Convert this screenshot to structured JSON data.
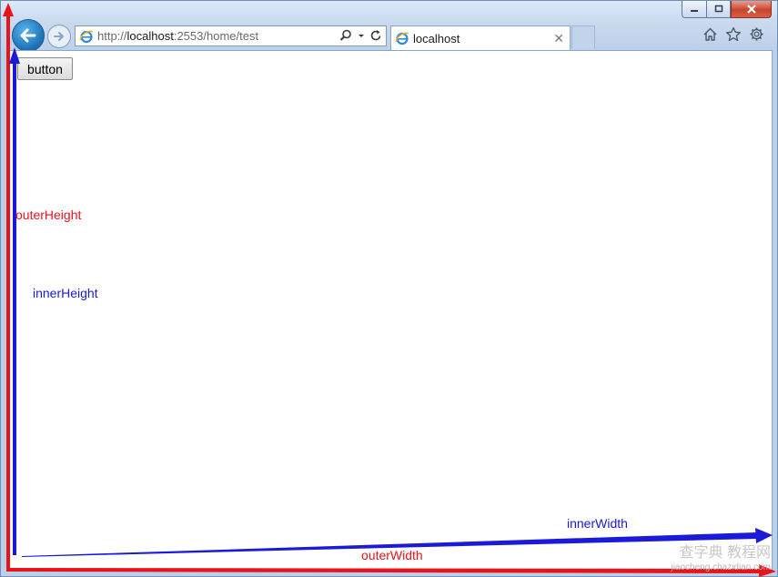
{
  "window": {
    "caption_buttons": {
      "minimize": "minimize-icon",
      "maximize": "maximize-icon",
      "close": "close-icon"
    }
  },
  "nav": {
    "back_icon": "back-arrow-icon",
    "forward_icon": "forward-arrow-icon"
  },
  "address_bar": {
    "url_prefix": "http://",
    "url_host": "localhost",
    "url_rest": ":2553/home/test"
  },
  "tab": {
    "title": "localhost"
  },
  "toolbar_icons": [
    "home-icon",
    "favorites-star-icon",
    "settings-gear-icon"
  ],
  "page": {
    "button_label": "button"
  },
  "annotations": {
    "outer_height": "outerHeight",
    "inner_height": "innerHeight",
    "inner_width": "innerWidth",
    "outer_width": "outerWidth",
    "colors": {
      "outer": "#e8141a",
      "inner": "#1a1ad8"
    }
  },
  "watermark": {
    "line1": "查字典 教程网",
    "line2": "jiaocheng.chazidian.com"
  }
}
